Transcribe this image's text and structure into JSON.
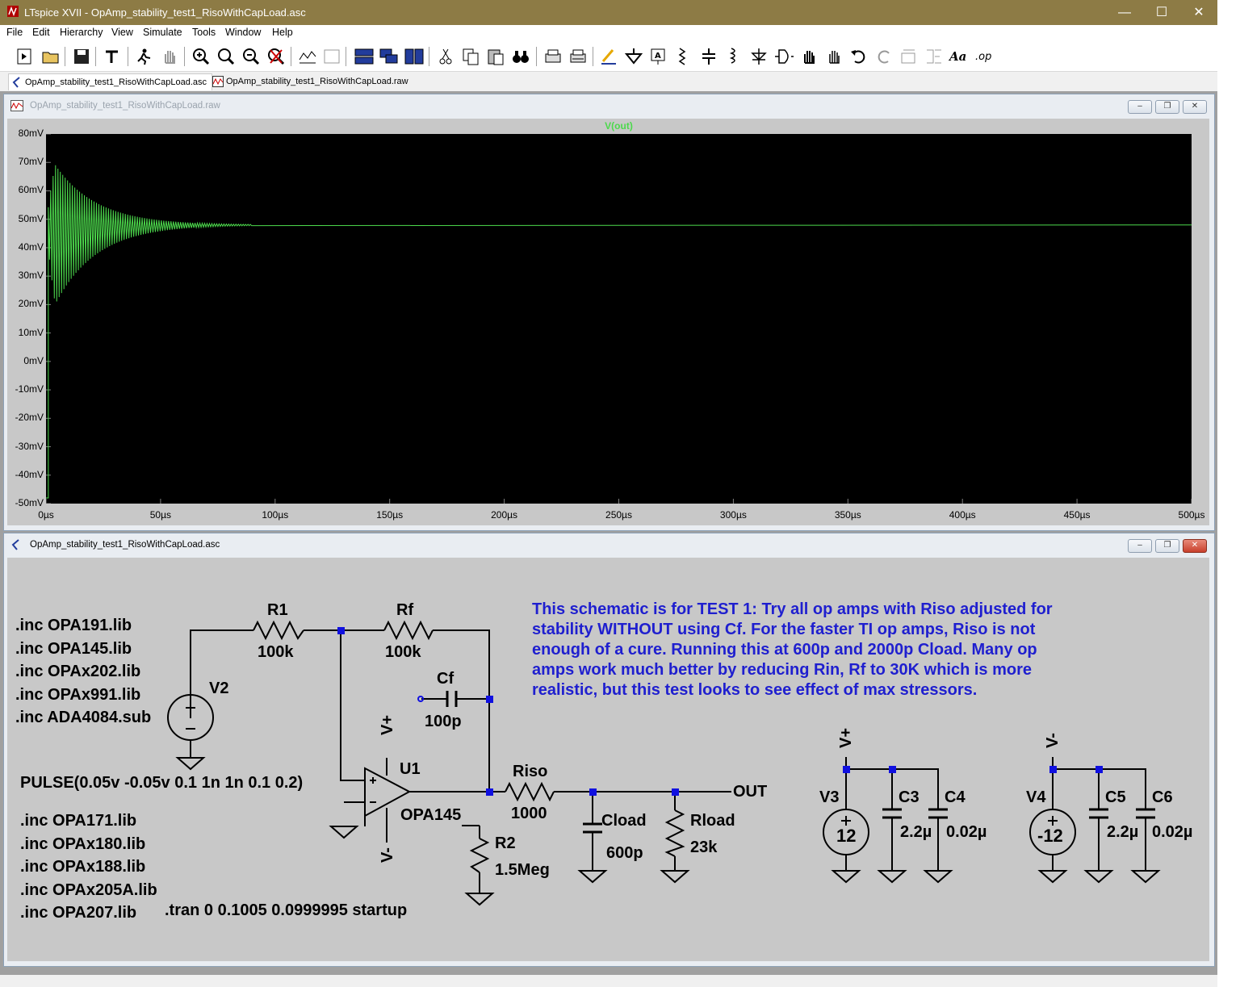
{
  "window": {
    "title": "LTspice XVII - OpAmp_stability_test1_RisoWithCapLoad.asc"
  },
  "menu": [
    "File",
    "Edit",
    "Hierarchy",
    "View",
    "Simulate",
    "Tools",
    "Window",
    "Help"
  ],
  "doc_tabs": [
    {
      "label": "OpAmp_stability_test1_RisoWithCapLoad.asc",
      "icon": "schematic-icon"
    },
    {
      "label": "OpAmp_stability_test1_RisoWithCapLoad.raw",
      "icon": "waveform-icon"
    }
  ],
  "waveform_window": {
    "title": "OpAmp_stability_test1_RisoWithCapLoad.raw",
    "trace_label": "V(out)",
    "trace_color": "#4cd94c",
    "background": "#000000"
  },
  "chart_data": {
    "type": "line",
    "series": [
      {
        "name": "V(out)",
        "description": "damped oscillation settling to ~48mV"
      }
    ],
    "x_ticks": [
      "0µs",
      "50µs",
      "100µs",
      "150µs",
      "200µs",
      "250µs",
      "300µs",
      "350µs",
      "400µs",
      "450µs",
      "500µs"
    ],
    "y_ticks": [
      "80mV",
      "70mV",
      "60mV",
      "50mV",
      "40mV",
      "30mV",
      "20mV",
      "10mV",
      "0mV",
      "-10mV",
      "-20mV",
      "-30mV",
      "-40mV",
      "-50mV"
    ],
    "xlim": [
      0,
      500
    ],
    "ylim": [
      -50,
      80
    ],
    "final_value": 48,
    "envelope": {
      "start_time_us": 1,
      "peak_max": 73,
      "peak_min": 15,
      "settle_time_us": 75
    }
  },
  "schematic_window": {
    "title": "OpAmp_stability_test1_RisoWithCapLoad.asc",
    "directives_top": [
      ".inc OPA191.lib",
      ".inc OPA145.lib",
      ".inc OPAx202.lib",
      ".inc OPAx991.lib",
      ".inc ADA4084.sub"
    ],
    "directives_bottom": [
      ".inc OPA171.lib",
      ".inc OPAx180.lib",
      ".inc OPAx188.lib",
      ".inc OPAx205A.lib",
      ".inc OPA207.lib"
    ],
    "tran": ".tran 0 0.1005 0.0999995 startup",
    "pulse": "PULSE(0.05v -0.05v 0.1 1n 1n 0.1 0.2)",
    "comment": [
      "This schematic is for TEST 1: Try all op amps with Riso adjusted for",
      "stability WITHOUT using Cf. For the faster TI op amps, Riso is not",
      "enough of a cure. Running this at 600p and 2000p Cload. Many op",
      "amps work much better by reducing Rin, Rf to 30K which is more",
      "realistic, but this test looks to see effect of max stressors."
    ],
    "labels": {
      "r1": "R1",
      "r1_val": "100k",
      "rf": "Rf",
      "rf_val": "100k",
      "cf": "Cf",
      "cf_val": "100p",
      "v2": "V2",
      "u1": "U1",
      "u1_model": "OPA145",
      "vplus": "V+",
      "vminus": "V-",
      "riso": "Riso",
      "riso_val": "1000",
      "r2": "R2",
      "r2_val": "1.5Meg",
      "cload": "Cload",
      "cload_val": "600p",
      "rload": "Rload",
      "rload_val": "23k",
      "out": "OUT",
      "v3": "V3",
      "v3_val": "12",
      "c3": "C3",
      "c3_val": "2.2µ",
      "c4": "C4",
      "c4_val": "0.02µ",
      "vplus2": "V+",
      "v4": "V4",
      "v4_val": "-12",
      "c5": "C5",
      "c5_val": "2.2µ",
      "c6": "C6",
      "c6_val": "0.02µ",
      "vminus2": "V-"
    }
  }
}
